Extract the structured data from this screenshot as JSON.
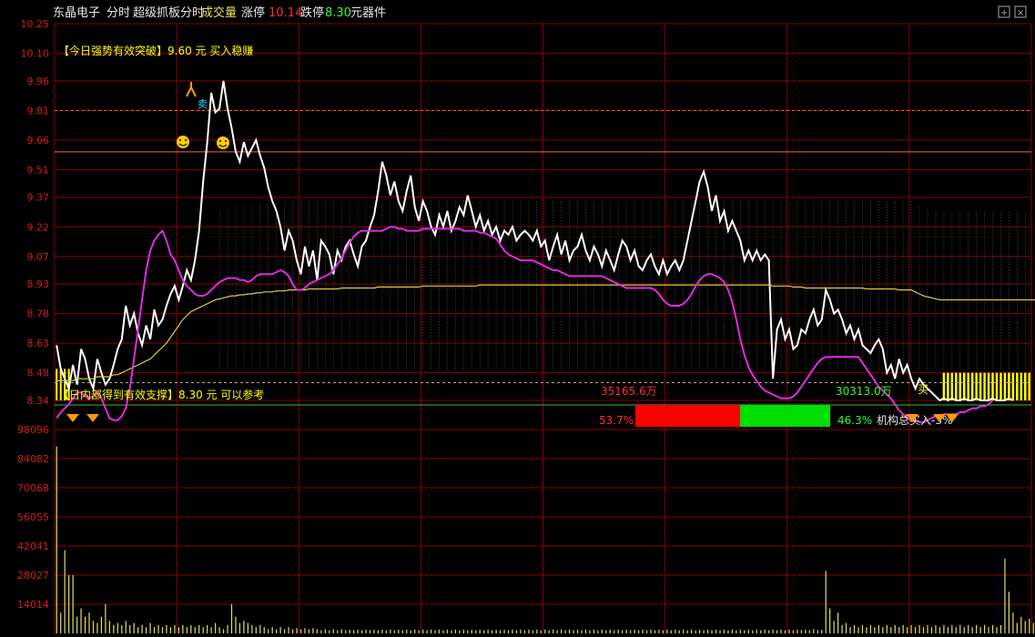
{
  "header": {
    "stock_name": "东晶电子",
    "mode": "分时",
    "indicator_name": "超级抓板分时",
    "volume_label": "成交量",
    "limit_up_label": "涨停",
    "limit_up_value": "10.14",
    "limit_down_label": "跌停",
    "limit_down_value": "8.30",
    "sector": "元器件"
  },
  "annotations": {
    "breakout_signal": "【今日强势有效突破】9.60 元 买入稳赚",
    "support_signal": "【日内部得到有效支撑】8.30 元 可以参考",
    "buy_mark": "买",
    "sell_mark": "卖",
    "buy_amount": "35165.6万",
    "sell_amount": "30313.0万",
    "buy_pct": "53.7%",
    "sell_pct": "46.3%",
    "institution_text": "机构总买入-3%"
  },
  "colors": {
    "background": "#000000",
    "grid": "#8b0000",
    "axis_label": "#d11f1f",
    "price_line": "#ffffff",
    "avg_line": "#d8d040",
    "institution_line": "#e02ce0",
    "buy_bar": "#ff0000",
    "sell_bar": "#00dd00",
    "volume_bar": "#e8e060",
    "signal_text": "#ffff00",
    "limit_up": "#ff3030",
    "limit_down": "#30ff30"
  },
  "chart_data": [
    {
      "type": "line",
      "panel": "intraday price",
      "y_ticks": [
        "10.25",
        "10.10",
        "9.96",
        "9.81",
        "9.66",
        "9.51",
        "9.37",
        "9.22",
        "9.07",
        "8.93",
        "8.78",
        "8.63",
        "8.48",
        "8.34"
      ],
      "ylim": [
        8.34,
        10.25
      ],
      "x_points": 240,
      "series": [
        {
          "key": "price",
          "values": [
            8.62,
            8.5,
            8.45,
            8.4,
            8.52,
            8.42,
            8.6,
            8.55,
            8.45,
            8.4,
            8.55,
            8.48,
            8.42,
            8.45,
            8.52,
            8.6,
            8.65,
            8.82,
            8.72,
            8.78,
            8.68,
            8.62,
            8.72,
            8.65,
            8.8,
            8.72,
            8.75,
            8.82,
            8.88,
            8.92,
            8.85,
            8.92,
            9.0,
            8.95,
            9.05,
            9.2,
            9.45,
            9.65,
            9.9,
            9.8,
            9.82,
            9.96,
            9.82,
            9.72,
            9.6,
            9.55,
            9.65,
            9.58,
            9.62,
            9.66,
            9.58,
            9.52,
            9.42,
            9.35,
            9.3,
            9.22,
            9.1,
            9.2,
            9.15,
            9.05,
            8.98,
            9.12,
            9.02,
            9.1,
            8.95,
            9.15,
            9.12,
            9.08,
            8.98,
            9.1,
            9.05,
            9.12,
            9.15,
            9.08,
            9.02,
            9.12,
            9.15,
            9.22,
            9.28,
            9.4,
            9.55,
            9.48,
            9.38,
            9.45,
            9.35,
            9.3,
            9.4,
            9.48,
            9.32,
            9.25,
            9.35,
            9.3,
            9.22,
            9.18,
            9.28,
            9.22,
            9.3,
            9.2,
            9.25,
            9.32,
            9.28,
            9.38,
            9.3,
            9.22,
            9.28,
            9.2,
            9.25,
            9.18,
            9.22,
            9.15,
            9.2,
            9.18,
            9.22,
            9.15,
            9.18,
            9.2,
            9.18,
            9.15,
            9.2,
            9.12,
            9.15,
            9.05,
            9.12,
            9.18,
            9.08,
            9.15,
            9.05,
            9.1,
            9.12,
            9.18,
            9.1,
            9.05,
            9.12,
            9.08,
            9.02,
            9.1,
            9.05,
            9.0,
            9.08,
            9.15,
            9.12,
            9.05,
            9.1,
            9.02,
            9.0,
            9.05,
            9.08,
            9.02,
            8.98,
            9.05,
            8.98,
            9.02,
            9.05,
            9.0,
            9.05,
            9.15,
            9.25,
            9.35,
            9.45,
            9.5,
            9.42,
            9.3,
            9.38,
            9.25,
            9.3,
            9.2,
            9.25,
            9.2,
            9.15,
            9.05,
            9.1,
            9.05,
            9.1,
            9.05,
            9.08,
            9.05,
            8.45,
            8.7,
            8.75,
            8.65,
            8.7,
            8.6,
            8.62,
            8.7,
            8.68,
            8.75,
            8.8,
            8.72,
            8.75,
            8.9,
            8.85,
            8.78,
            8.8,
            8.75,
            8.68,
            8.72,
            8.65,
            8.7,
            8.62,
            8.6,
            8.58,
            8.62,
            8.65,
            8.6,
            8.48,
            8.52,
            8.45,
            8.55,
            8.48,
            8.52,
            8.45,
            8.4,
            8.45,
            8.42,
            8.4,
            8.38,
            8.36,
            8.34,
            8.35,
            8.34,
            8.35,
            8.34,
            8.34,
            8.35,
            8.34,
            8.34,
            8.35,
            8.34,
            8.34,
            8.34,
            8.35,
            8.34,
            8.34,
            8.34,
            8.35,
            8.34
          ]
        },
        {
          "key": "average",
          "values": [
            8.44,
            8.44,
            8.44,
            8.44,
            8.44,
            8.45,
            8.45,
            8.45,
            8.45,
            8.45,
            8.46,
            8.46,
            8.46,
            8.46,
            8.47,
            8.47,
            8.48,
            8.49,
            8.5,
            8.51,
            8.52,
            8.53,
            8.54,
            8.55,
            8.57,
            8.59,
            8.61,
            8.63,
            8.66,
            8.69,
            8.72,
            8.75,
            8.77,
            8.79,
            8.8,
            8.81,
            8.82,
            8.83,
            8.84,
            8.85,
            8.855,
            8.86,
            8.865,
            8.87,
            8.87,
            8.875,
            8.875,
            8.88,
            8.88,
            8.885,
            8.885,
            8.89,
            8.89,
            8.89,
            8.895,
            8.895,
            8.895,
            8.9,
            8.9,
            8.9,
            8.9,
            8.9,
            8.905,
            8.905,
            8.905,
            8.905,
            8.905,
            8.905,
            8.905,
            8.905,
            8.91,
            8.91,
            8.91,
            8.91,
            8.91,
            8.91,
            8.91,
            8.91,
            8.91,
            8.915,
            8.915,
            8.915,
            8.915,
            8.915,
            8.915,
            8.915,
            8.915,
            8.915,
            8.915,
            8.915,
            8.92,
            8.92,
            8.92,
            8.92,
            8.92,
            8.92,
            8.92,
            8.92,
            8.92,
            8.92,
            8.92,
            8.92,
            8.92,
            8.92,
            8.925,
            8.925,
            8.925,
            8.925,
            8.925,
            8.925,
            8.925,
            8.925,
            8.925,
            8.925,
            8.925,
            8.925,
            8.925,
            8.925,
            8.925,
            8.925,
            8.925,
            8.925,
            8.925,
            8.925,
            8.925,
            8.925,
            8.925,
            8.925,
            8.925,
            8.925,
            8.925,
            8.925,
            8.925,
            8.925,
            8.925,
            8.925,
            8.925,
            8.925,
            8.925,
            8.925,
            8.925,
            8.925,
            8.925,
            8.925,
            8.925,
            8.925,
            8.925,
            8.925,
            8.925,
            8.925,
            8.925,
            8.925,
            8.925,
            8.925,
            8.925,
            8.925,
            8.925,
            8.925,
            8.925,
            8.925,
            8.925,
            8.925,
            8.925,
            8.925,
            8.925,
            8.925,
            8.925,
            8.925,
            8.925,
            8.925,
            8.925,
            8.925,
            8.925,
            8.925,
            8.925,
            8.925,
            8.92,
            8.92,
            8.92,
            8.92,
            8.92,
            8.915,
            8.915,
            8.915,
            8.91,
            8.91,
            8.91,
            8.91,
            8.91,
            8.91,
            8.91,
            8.91,
            8.91,
            8.91,
            8.91,
            8.91,
            8.91,
            8.91,
            8.91,
            8.905,
            8.905,
            8.905,
            8.905,
            8.905,
            8.905,
            8.905,
            8.905,
            8.9,
            8.9,
            8.9,
            8.9,
            8.89,
            8.88,
            8.87,
            8.865,
            8.86,
            8.855,
            8.85,
            8.85,
            8.85,
            8.85,
            8.85,
            8.85,
            8.85,
            8.85,
            8.85,
            8.85,
            8.85,
            8.85,
            8.85,
            8.85,
            8.85,
            8.85,
            8.85,
            8.85,
            8.85,
            8.85,
            8.85,
            8.85,
            8.85,
            8.85,
            8.85,
            8.85,
            8.85
          ]
        },
        {
          "key": "institution",
          "values": [
            8.25,
            8.28,
            8.3,
            8.32,
            8.35,
            8.38,
            8.38,
            8.36,
            8.35,
            8.36,
            8.38,
            8.35,
            8.3,
            8.25,
            8.24,
            8.24,
            8.26,
            8.3,
            8.4,
            8.55,
            8.7,
            8.85,
            9.0,
            9.1,
            9.15,
            9.18,
            9.2,
            9.15,
            9.08,
            9.05,
            9.0,
            8.95,
            8.92,
            8.9,
            8.88,
            8.87,
            8.87,
            8.88,
            8.9,
            8.92,
            8.94,
            8.95,
            8.96,
            8.96,
            8.96,
            8.95,
            8.95,
            8.94,
            8.95,
            8.97,
            8.98,
            8.98,
            8.98,
            8.98,
            8.99,
            9.0,
            8.99,
            8.97,
            8.93,
            8.9,
            8.9,
            8.91,
            8.93,
            8.94,
            8.95,
            8.96,
            8.97,
            8.98,
            9.0,
            9.03,
            9.06,
            9.1,
            9.14,
            9.17,
            9.19,
            9.2,
            9.2,
            9.2,
            9.2,
            9.2,
            9.2,
            9.21,
            9.22,
            9.22,
            9.21,
            9.21,
            9.2,
            9.2,
            9.2,
            9.2,
            9.21,
            9.21,
            9.21,
            9.21,
            9.21,
            9.21,
            9.21,
            9.21,
            9.21,
            9.21,
            9.2,
            9.2,
            9.2,
            9.2,
            9.19,
            9.19,
            9.18,
            9.17,
            9.16,
            9.13,
            9.1,
            9.08,
            9.07,
            9.06,
            9.05,
            9.05,
            9.05,
            9.05,
            9.04,
            9.03,
            9.02,
            9.01,
            9.0,
            9.0,
            8.99,
            8.98,
            8.97,
            8.97,
            8.97,
            8.97,
            8.97,
            8.97,
            8.97,
            8.97,
            8.97,
            8.96,
            8.95,
            8.94,
            8.93,
            8.92,
            8.91,
            8.91,
            8.91,
            8.91,
            8.91,
            8.91,
            8.91,
            8.9,
            8.88,
            8.85,
            8.83,
            8.82,
            8.82,
            8.82,
            8.83,
            8.85,
            8.88,
            8.92,
            8.95,
            8.97,
            8.98,
            8.98,
            8.97,
            8.96,
            8.94,
            8.9,
            8.84,
            8.75,
            8.65,
            8.57,
            8.51,
            8.47,
            8.44,
            8.41,
            8.39,
            8.38,
            8.37,
            8.36,
            8.35,
            8.35,
            8.35,
            8.36,
            8.38,
            8.41,
            8.44,
            8.47,
            8.5,
            8.53,
            8.55,
            8.56,
            8.56,
            8.56,
            8.56,
            8.56,
            8.56,
            8.56,
            8.56,
            8.56,
            8.53,
            8.5,
            8.47,
            8.44,
            8.41,
            8.39,
            8.37,
            8.35,
            8.32,
            8.29,
            8.27,
            8.25,
            8.24,
            8.24,
            8.23,
            8.23,
            8.24,
            8.25,
            8.26,
            8.26,
            8.27,
            8.27,
            8.27,
            8.27,
            8.28,
            8.28,
            8.29,
            8.3,
            8.3,
            8.31,
            8.31,
            8.32,
            8.34
          ]
        }
      ]
    },
    {
      "type": "bar",
      "panel": "volume",
      "y_ticks": [
        "98096",
        "84082",
        "70068",
        "56055",
        "42041",
        "28027",
        "14014"
      ],
      "ylim": [
        0,
        98096
      ],
      "values": [
        90000,
        10000,
        40000,
        28000,
        28000,
        8000,
        12000,
        8000,
        10000,
        6000,
        5000,
        8000,
        14000,
        6000,
        4000,
        5000,
        4000,
        6000,
        4000,
        5000,
        3000,
        4000,
        3000,
        5000,
        3000,
        4000,
        3000,
        4000,
        3000,
        4000,
        3000,
        4000,
        3000,
        4000,
        3000,
        4000,
        3000,
        4000,
        3000,
        5000,
        3000,
        2000,
        4000,
        14000,
        8000,
        5000,
        6000,
        5000,
        4000,
        3000,
        4000,
        3000,
        2000,
        3000,
        2000,
        3000,
        2000,
        3000,
        2000,
        2500,
        2000,
        2500,
        2000,
        2500,
        2000,
        1500,
        2000,
        1500,
        2000,
        1500,
        2000,
        1500,
        1800,
        1500,
        1800,
        1500,
        1800,
        1500,
        1800,
        1500,
        1800,
        1500,
        1800,
        1500,
        1800,
        1500,
        1800,
        1500,
        1800,
        1500,
        1800,
        1500,
        1800,
        1500,
        1800,
        1500,
        1800,
        1500,
        1800,
        1500,
        1800,
        1500,
        1800,
        1500,
        1800,
        1500,
        1800,
        1500,
        1800,
        1500,
        1800,
        1500,
        1800,
        1500,
        1800,
        1500,
        1800,
        1500,
        1800,
        1500,
        1800,
        1500,
        1800,
        1500,
        1800,
        1500,
        1800,
        1500,
        1800,
        1500,
        1800,
        1500,
        1800,
        1500,
        1800,
        1500,
        1800,
        1500,
        1800,
        1500,
        1800,
        1500,
        1800,
        1500,
        1800,
        1500,
        1800,
        1500,
        1800,
        1500,
        1800,
        1500,
        1800,
        1500,
        1800,
        1500,
        1800,
        1500,
        1800,
        1500,
        1800,
        1500,
        1800,
        1500,
        1800,
        1500,
        1800,
        1500,
        1800,
        1500,
        1800,
        1500,
        1800,
        1500,
        1800,
        1500,
        1800,
        1500,
        1800,
        1500,
        1800,
        1500,
        1800,
        1500,
        1800,
        1500,
        2000,
        1500,
        1800,
        30000,
        12000,
        6000,
        10000,
        4000,
        5000,
        3000,
        4000,
        3000,
        4000,
        3000,
        4000,
        3000,
        4000,
        3000,
        4000,
        3000,
        4000,
        3000,
        4000,
        3000,
        4000,
        3000,
        4000,
        3000,
        4000,
        3000,
        4000,
        3000,
        4000,
        3000,
        4000,
        3000,
        4000,
        3000,
        4000,
        3000,
        4000,
        3000,
        4000,
        3000,
        4000,
        3000,
        4000,
        36000,
        20000,
        10000,
        5000,
        8000,
        6000,
        7000,
        5000,
        6000,
        4000,
        5000,
        4000
      ]
    }
  ]
}
